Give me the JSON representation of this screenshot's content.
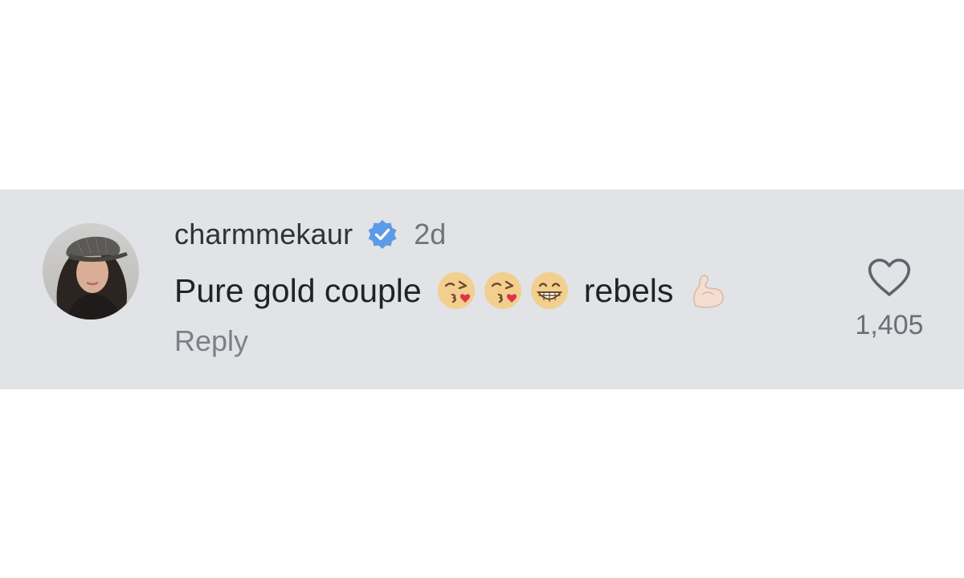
{
  "comment": {
    "username": "charmmekaur",
    "timestamp": "2d",
    "text_before": "Pure gold couple",
    "emojis_a": [
      "kissing-face-with-heart",
      "kissing-face-with-heart",
      "grinning-face"
    ],
    "text_after": "rebels",
    "emojis_b": [
      "flexed-biceps"
    ],
    "reply_label": "Reply",
    "like_count": "1,405",
    "verified": true
  },
  "colors": {
    "band_background": "#e1e3e6",
    "verified_blue": "#5b9be8",
    "username": "#2f3236",
    "muted": "#6f7479"
  }
}
